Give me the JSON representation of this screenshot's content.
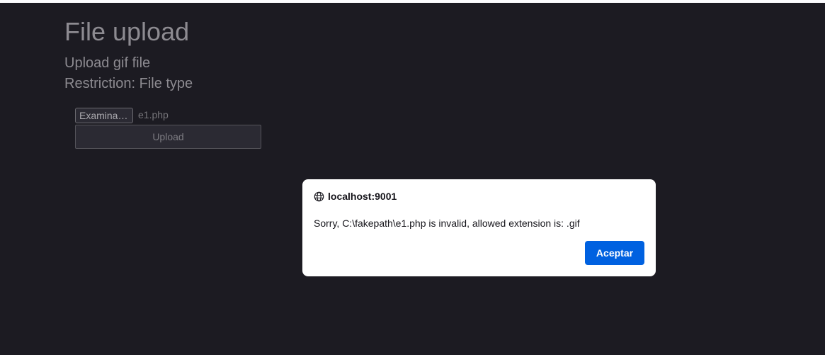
{
  "page": {
    "title": "File upload",
    "subtitle": "Upload gif file",
    "restriction": "Restriction: File type"
  },
  "form": {
    "browse_label": "Examinar…",
    "selected_file": "e1.php",
    "upload_label": "Upload"
  },
  "dialog": {
    "origin": "localhost:9001",
    "origin_icon": "globe-icon",
    "message": "Sorry, C:\\fakepath\\e1.php is invalid, allowed extension is: .gif",
    "accept_label": "Aceptar",
    "accent_color": "#0061e0"
  }
}
